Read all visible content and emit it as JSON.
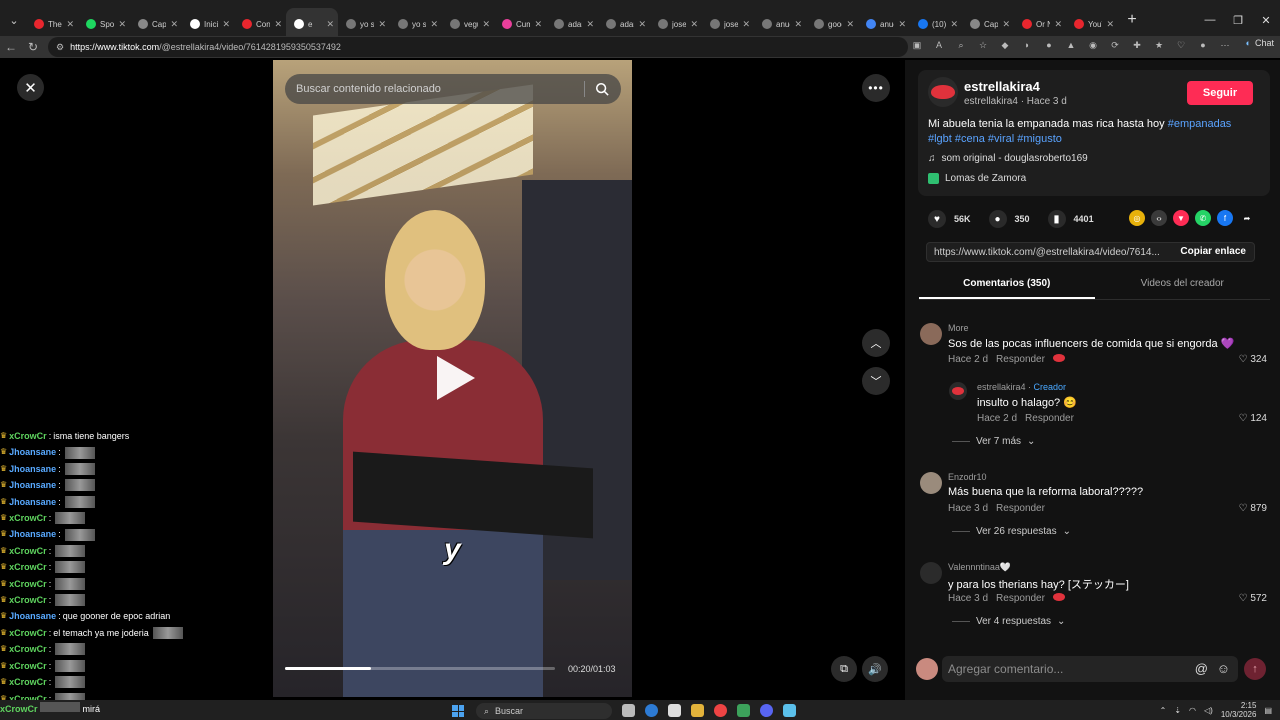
{
  "browser": {
    "tabs": [
      {
        "title": "TheG",
        "color": "#e8262e"
      },
      {
        "title": "Spoti",
        "color": "#1ed760"
      },
      {
        "title": "Capt",
        "color": "#888888"
      },
      {
        "title": "Inicio",
        "color": "#ffffff"
      },
      {
        "title": "Cons",
        "color": "#e8262e"
      },
      {
        "title": "e",
        "color": "#ffffff"
      },
      {
        "title": "yo s",
        "color": "#777777"
      },
      {
        "title": "yo s",
        "color": "#777777"
      },
      {
        "title": "vegu",
        "color": "#777777"
      },
      {
        "title": "Cum",
        "color": "#e93f9b"
      },
      {
        "title": "adam",
        "color": "#777777"
      },
      {
        "title": "adam",
        "color": "#777777"
      },
      {
        "title": "josep",
        "color": "#777777"
      },
      {
        "title": "josep",
        "color": "#777777"
      },
      {
        "title": "anue",
        "color": "#777777"
      },
      {
        "title": "goog",
        "color": "#777777"
      },
      {
        "title": "anue",
        "color": "#4285f4"
      },
      {
        "title": "(10) F",
        "color": "#1877f2"
      },
      {
        "title": "Capt",
        "color": "#888888"
      },
      {
        "title": "Or N",
        "color": "#e8262e"
      },
      {
        "title": "YouT",
        "color": "#e8262e"
      }
    ],
    "active_tab_index": 5,
    "url_host": "https://www.tiktok.com",
    "url_path": "/@estrellakira4/video/7614281959350537492",
    "chat_label": "Chat"
  },
  "video": {
    "search_placeholder": "Buscar contenido relacionado",
    "time": "00:20/01:03",
    "progress": 0.32,
    "sticker": "y"
  },
  "chat_overlay": {
    "lines": [
      {
        "user": "xCrowCr",
        "kind": "b",
        "msg": "isma tiene bangers",
        "emote": false
      },
      {
        "user": "Jhoansane",
        "kind": "a",
        "msg": "",
        "emote": true
      },
      {
        "user": "Jhoansane",
        "kind": "a",
        "msg": "",
        "emote": true
      },
      {
        "user": "Jhoansane",
        "kind": "a",
        "msg": "",
        "emote": true
      },
      {
        "user": "Jhoansane",
        "kind": "a",
        "msg": "",
        "emote": true
      },
      {
        "user": "xCrowCr",
        "kind": "b",
        "msg": "",
        "emote": true
      },
      {
        "user": "Jhoansane",
        "kind": "a",
        "msg": "",
        "emote": true
      },
      {
        "user": "xCrowCr",
        "kind": "b",
        "msg": "",
        "emote": true
      },
      {
        "user": "xCrowCr",
        "kind": "b",
        "msg": "",
        "emote": true
      },
      {
        "user": "xCrowCr",
        "kind": "b",
        "msg": "",
        "emote": true
      },
      {
        "user": "xCrowCr",
        "kind": "b",
        "msg": "",
        "emote": true
      },
      {
        "user": "Jhoansane",
        "kind": "a",
        "msg": "que gooner de epoc adrian",
        "emote": false
      },
      {
        "user": "xCrowCr",
        "kind": "b",
        "msg": "el temach ya me joderia",
        "emote": true
      },
      {
        "user": "xCrowCr",
        "kind": "b",
        "msg": "",
        "emote": true
      },
      {
        "user": "xCrowCr",
        "kind": "b",
        "msg": "",
        "emote": true
      },
      {
        "user": "xCrowCr",
        "kind": "b",
        "msg": "",
        "emote": true
      },
      {
        "user": "xCrowCr",
        "kind": "b",
        "msg": "",
        "emote": true
      }
    ],
    "last_msg": "mirá"
  },
  "creator": {
    "name": "estrellakira4",
    "sub": "estrellakira4 · Hace 3 d",
    "follow": "Seguir",
    "desc_text": "Mi abuela tenia la empanada mas rica hasta hoy ",
    "desc_tags": "#empanadas #lgbt #cena #viral #migusto",
    "music": "som original - douglasroberto169",
    "location": "Lomas de Zamora"
  },
  "stats": {
    "likes": "56K",
    "comments": "350",
    "saves": "4401"
  },
  "link": {
    "url": "https://www.tiktok.com/@estrellakira4/video/7614...",
    "copy_label": "Copiar enlace"
  },
  "tabs": {
    "comments": "Comentarios (350)",
    "creator_videos": "Videos del creador"
  },
  "comments": [
    {
      "user": "More",
      "text": "Sos de las pocas influencers de comida que si engorda 💜",
      "time": "Hace 2 d",
      "reply": "Responder",
      "likes": "324"
    },
    {
      "user": "estrellakira4",
      "creator_label": "Creador",
      "text": "insulto o halago? 😊",
      "time": "Hace 2 d",
      "reply": "Responder",
      "likes": "124"
    },
    {
      "more": "Ver 7 más"
    },
    {
      "user": "Enzodr10",
      "text": "Más buena que la reforma laboral?????",
      "time": "Hace 3 d",
      "reply": "Responder",
      "likes": "879"
    },
    {
      "more": "Ver 26 respuestas"
    },
    {
      "user": "Valennntinaa🤍",
      "text": "y para los therians hay? [ステッカー]",
      "time": "Hace 3 d",
      "reply": "Responder",
      "likes": "572"
    },
    {
      "more": "Ver 4 respuestas"
    }
  ],
  "comment_input": {
    "placeholder": "Agregar comentario..."
  },
  "taskbar": {
    "search": "Buscar",
    "time": "2:15",
    "date": "10/3/2026"
  }
}
